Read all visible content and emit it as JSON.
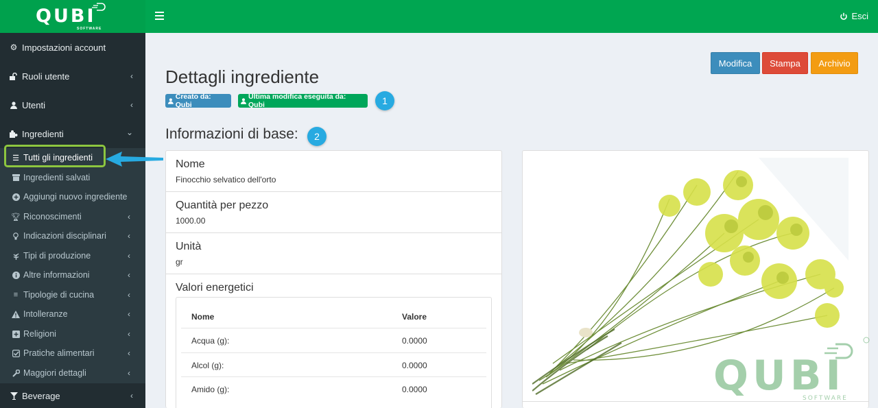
{
  "header": {
    "logo_text": "QUBI",
    "logo_sub": "SOFTWARE",
    "logout_label": "Esci"
  },
  "sidebar": {
    "items": [
      {
        "label": "Impostazioni account",
        "icon": "gear-icon"
      },
      {
        "label": "Ruoli utente",
        "icon": "unlock-icon"
      },
      {
        "label": "Utenti",
        "icon": "user-icon"
      },
      {
        "label": "Ingredienti",
        "icon": "puzzle-icon"
      }
    ],
    "submenu": [
      {
        "label": "Tutti gli ingredienti",
        "icon": "list-icon"
      },
      {
        "label": "Ingredienti salvati",
        "icon": "archive-icon"
      },
      {
        "label": "Aggiungi nuovo ingrediente",
        "icon": "plus-circle-icon"
      },
      {
        "label": "Riconoscimenti",
        "icon": "trophy-icon"
      },
      {
        "label": "Indicazioni disciplinari",
        "icon": "lightbulb-icon"
      },
      {
        "label": "Tipi di produzione",
        "icon": "leaf-icon"
      },
      {
        "label": "Altre informazioni",
        "icon": "info-circle-icon"
      },
      {
        "label": "Tipologie di cucina",
        "icon": "list-lines-icon"
      },
      {
        "label": "Intolleranze",
        "icon": "warning-icon"
      },
      {
        "label": "Religioni",
        "icon": "plus-square-icon"
      },
      {
        "label": "Pratiche alimentari",
        "icon": "check-square-icon"
      },
      {
        "label": "Maggiori dettagli",
        "icon": "wrench-icon"
      }
    ],
    "bottom_item": {
      "label": "Beverage",
      "icon": "glass-icon"
    }
  },
  "page": {
    "title": "Dettagli ingrediente",
    "badge_created": "Creato da: Qubi",
    "badge_modified": "Ultima modifica eseguita da: Qubi",
    "step1": "1",
    "step2": "2",
    "section_title": "Informazioni di base:"
  },
  "actions": {
    "edit": "Modifica",
    "print": "Stampa",
    "archive": "Archivio"
  },
  "info": {
    "name_label": "Nome",
    "name_value": "Finocchio selvatico dell'orto",
    "qty_label": "Quantità per pezzo",
    "qty_value": "1000.00",
    "unit_label": "Unità",
    "unit_value": "gr",
    "energy_label": "Valori energetici"
  },
  "energy_table": {
    "col_name": "Nome",
    "col_value": "Valore",
    "rows": [
      {
        "name": "Acqua (g):",
        "value": "0.0000"
      },
      {
        "name": "Alcol (g):",
        "value": "0.0000"
      },
      {
        "name": "Amido (g):",
        "value": "0.0000"
      }
    ]
  },
  "colors": {
    "brand_green": "#00a651",
    "sidebar_bg": "#222d32",
    "highlight": "#8dc63f",
    "step_blue": "#27aae1"
  }
}
